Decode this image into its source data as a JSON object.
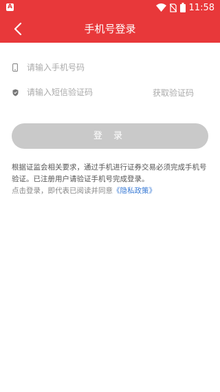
{
  "status_bar": {
    "app_icon_letter": "A",
    "time": "11:58",
    "icons": [
      "wifi-icon",
      "no-sim-icon",
      "battery-icon"
    ]
  },
  "header": {
    "title": "手机号登录",
    "back_icon": "chevron-left-icon"
  },
  "form": {
    "phone_placeholder": "请输入手机号码",
    "code_placeholder": "请输入短信验证码",
    "get_code_label": "获取验证码",
    "phone_icon": "phone-icon",
    "code_icon": "shield-icon"
  },
  "login_button": {
    "label": "登 录"
  },
  "notice": {
    "text": "根据证监会相关要求，通过手机进行证券交易必须完成手机号验证。已注册用户请验证手机号完成登录。"
  },
  "agreement": {
    "prefix": "点击登录，即代表已阅读并同意",
    "link": "《隐私政策》"
  },
  "colors": {
    "brand_red": "#e8383a",
    "button_disabled": "#c9c9c9",
    "link_blue": "#3a7bd5"
  }
}
